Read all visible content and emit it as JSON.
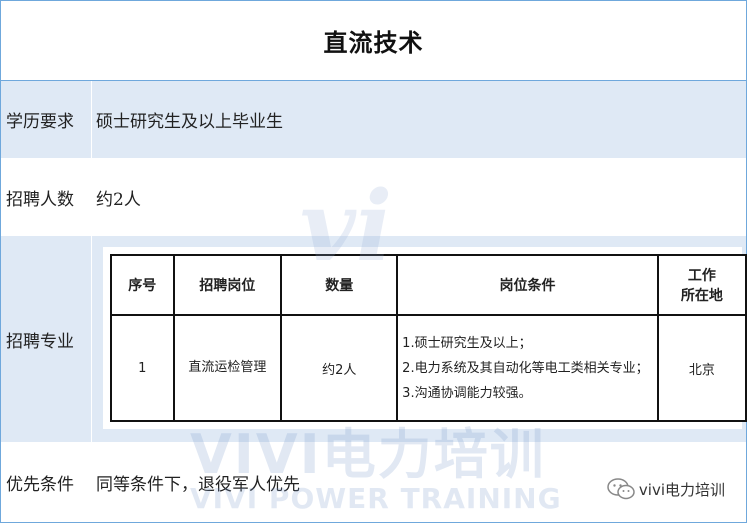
{
  "title": "直流技术",
  "rows": {
    "education": {
      "label": "学历要求",
      "value": "硕士研究生及以上毕业生"
    },
    "headcount": {
      "label": "招聘人数",
      "value": "约2人"
    },
    "major": {
      "label": "招聘专业"
    },
    "priority": {
      "label": "优先条件",
      "value": "同等条件下，退役军人优先"
    }
  },
  "table": {
    "headers": {
      "seq": "序号",
      "position": "招聘岗位",
      "quantity": "数量",
      "conditions": "岗位条件",
      "location_line1": "工作",
      "location_line2": "所在地"
    },
    "row": {
      "seq": "1",
      "position": "直流运检管理",
      "quantity": "约2人",
      "conditions": [
        "1.硕士研究生及以上；",
        "2.电力系统及其自动化等电工类相关专业；",
        "3.沟通协调能力较强。"
      ],
      "location": "北京"
    }
  },
  "watermark": {
    "logo": "vi",
    "chinese": "VIVI电力培训",
    "english": "VIVI POWER TRAINING"
  },
  "footer": {
    "brand": "vivi电力培训",
    "icon": "wechat-icon"
  },
  "colors": {
    "row_blue": "#dfe9f5",
    "border_blue": "#6fa8dc"
  }
}
